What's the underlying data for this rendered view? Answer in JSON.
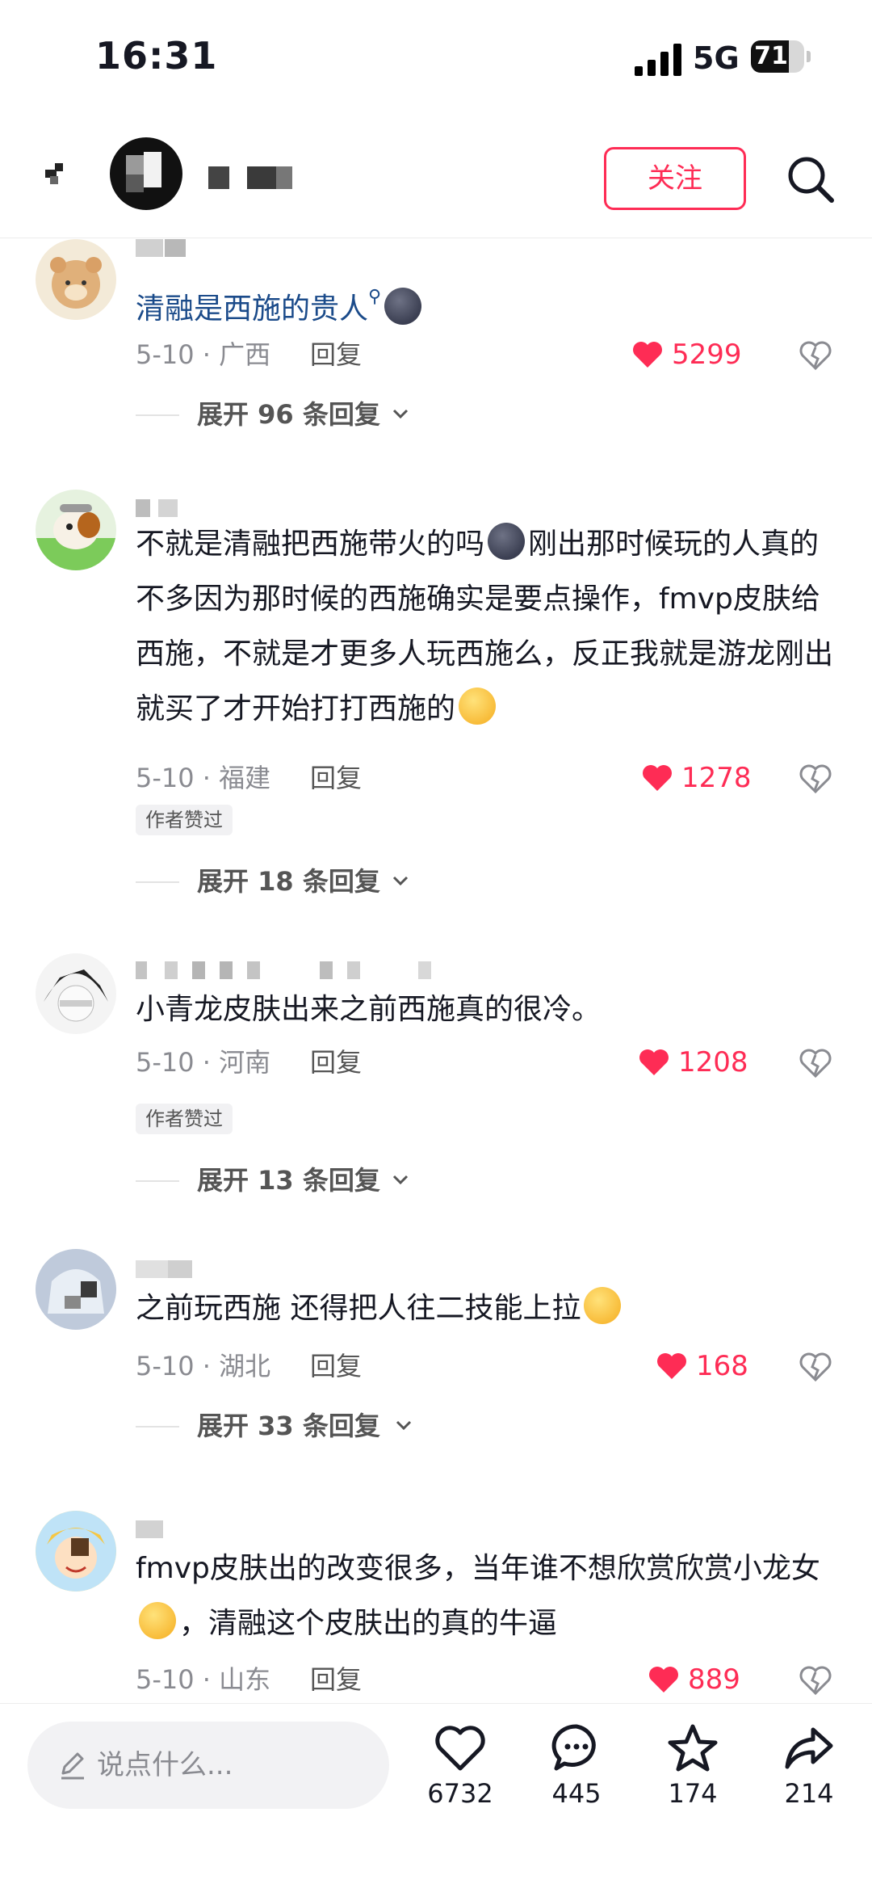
{
  "status_bar": {
    "time": "16:31",
    "network": "5G",
    "battery": "71",
    "battery_level": 0.71
  },
  "nav": {
    "follow_label": "关注"
  },
  "comments": [
    {
      "text_a": "清融是西施的贵人",
      "date": "5-10 · 广西",
      "reply": "回复",
      "likes": "5299",
      "expand": "展开 96 条回复"
    },
    {
      "text_a": "不就是清融把西施带火的吗",
      "text_b": "刚出那时候玩的人真的不多因为那时候的西施确实是要点操作，fmvp皮肤给西施，不就是才更多人玩西施么，反正我就是游龙刚出就买了才开始打打西施的",
      "date": "5-10 · 福建",
      "reply": "回复",
      "likes": "1278",
      "badge": "作者赞过",
      "expand": "展开 18 条回复"
    },
    {
      "text_a": "小青龙皮肤出来之前西施真的很冷。",
      "date": "5-10 · 河南",
      "reply": "回复",
      "likes": "1208",
      "badge": "作者赞过",
      "expand": "展开 13 条回复"
    },
    {
      "text_a": "之前玩西施 还得把人往二技能上拉",
      "date": "5-10 · 湖北",
      "reply": "回复",
      "likes": "168",
      "expand": "展开 33 条回复"
    },
    {
      "text_a": "fmvp皮肤出的改变很多，当年谁不想欣赏欣赏小龙女",
      "text_b": "，清融这个皮肤出的真的牛逼",
      "date": "5-10 · 山东",
      "reply": "回复",
      "likes": "889"
    }
  ],
  "bottom_bar": {
    "input_placeholder": "说点什么...",
    "like_count": "6732",
    "comment_count": "445",
    "favorite_count": "174",
    "share_count": "214"
  },
  "colors": {
    "accent": "#fe2c55",
    "text": "#161823",
    "muted": "#8a8b91",
    "link": "#1b4b8a"
  },
  "icons": [
    "back-icon",
    "search-icon",
    "heart-icon",
    "broken-heart-icon",
    "chevron-down-icon",
    "pencil-icon",
    "comment-icon",
    "star-icon",
    "share-icon"
  ]
}
